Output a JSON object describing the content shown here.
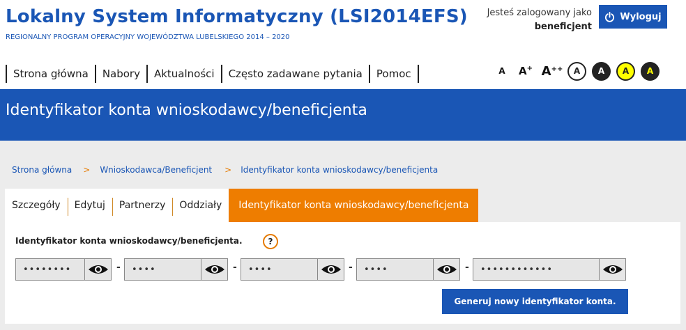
{
  "header": {
    "title": "Lokalny System Informatyczny (LSI2014EFS)",
    "subtitle": "REGIONALNY PROGRAM OPERACYJNY WOJEWÓDZTWA LUBELSKIEGO 2014 – 2020",
    "logged_in_label": "Jesteś zalogowany jako",
    "username": "beneficjent",
    "logout_label": "Wyloguj"
  },
  "nav": {
    "items": [
      "Strona główna",
      "Nabory",
      "Aktualności",
      "Często zadawane pytania",
      "Pomoc"
    ]
  },
  "accessibility": {
    "font_small": "A",
    "font_medium": "A",
    "font_medium_sup": "+",
    "font_large": "A",
    "font_large_sup": "++",
    "contrast_labels": [
      "A",
      "A",
      "A",
      "A"
    ],
    "contrast_colors": {
      "default": "#ffffff",
      "dark": "#222222",
      "yellow": "#ffff00",
      "yellow_on_black": "#ffff00"
    }
  },
  "banner": {
    "title": "Identyfikator konta wnioskodawcy/beneficjenta"
  },
  "breadcrumb": {
    "items": [
      "Strona główna",
      "Wnioskodawca/Beneficjent",
      "Identyfikator konta wnioskodawcy/beneficjenta"
    ],
    "separator": ">"
  },
  "tabs": {
    "items": [
      "Szczegóły",
      "Edytuj",
      "Partnerzy",
      "Oddziały",
      "Identyfikator konta wnioskodawcy/beneficjenta"
    ],
    "active_index": 4
  },
  "panel": {
    "label": "Identyfikator konta wnioskodawcy/beneficjenta.",
    "help": "?",
    "segments": [
      "••••••••",
      "••••",
      "••••",
      "••••",
      "••••••••••••"
    ],
    "separator": "-",
    "generate_label": "Generuj nowy identyfikator konta."
  },
  "colors": {
    "primary": "#1a56b5",
    "accent": "#ee7d00",
    "background": "#ececec"
  }
}
